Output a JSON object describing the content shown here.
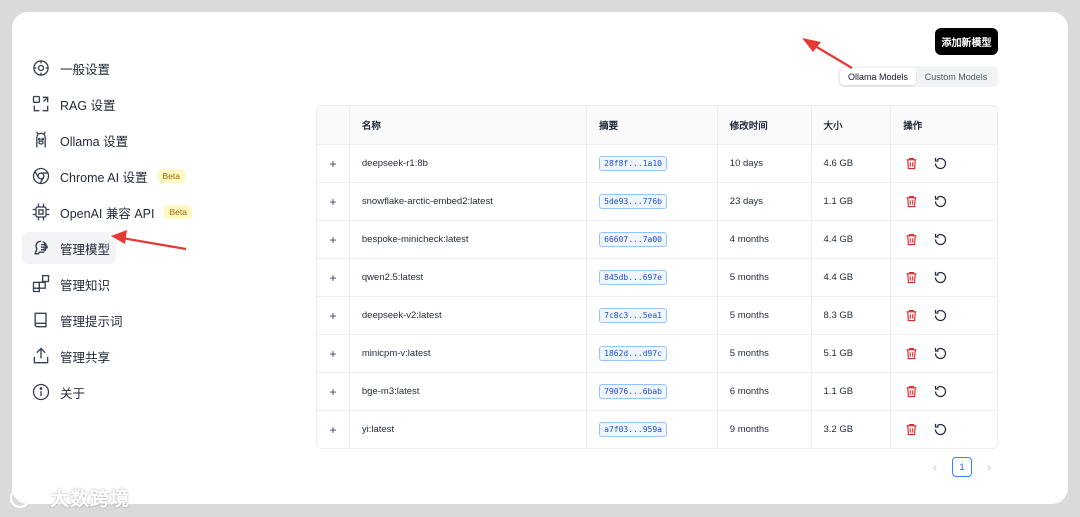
{
  "sidebar": {
    "items": [
      {
        "label": "一般设置",
        "icon": "settings-icon"
      },
      {
        "label": "RAG 设置",
        "icon": "rag-icon"
      },
      {
        "label": "Ollama 设置",
        "icon": "llama-icon"
      },
      {
        "label": "Chrome AI 设置",
        "icon": "chrome-icon",
        "badge": "Beta"
      },
      {
        "label": "OpenAI 兼容 API",
        "icon": "chip-icon",
        "badge": "Beta"
      },
      {
        "label": "管理模型",
        "icon": "brain-icon",
        "active": true
      },
      {
        "label": "管理知识",
        "icon": "blocks-icon"
      },
      {
        "label": "管理提示词",
        "icon": "book-icon"
      },
      {
        "label": "管理共享",
        "icon": "share-icon"
      },
      {
        "label": "关于",
        "icon": "info-icon"
      }
    ]
  },
  "header": {
    "add_button": "添加新模型",
    "tabs": [
      {
        "label": "Ollama Models",
        "active": true
      },
      {
        "label": "Custom Models",
        "active": false
      }
    ]
  },
  "table": {
    "columns": [
      "名称",
      "摘要",
      "修改时间",
      "大小",
      "操作"
    ],
    "expand_symbol": "+",
    "rows": [
      {
        "name": "deepseek-r1:8b",
        "digest": "28f8f...1a10",
        "modified": "10 days",
        "size": "4.6 GB"
      },
      {
        "name": "snowflake-arctic-embed2:latest",
        "digest": "5de93...776b",
        "modified": "23 days",
        "size": "1.1 GB"
      },
      {
        "name": "bespoke-minicheck:latest",
        "digest": "66607...7a00",
        "modified": "4 months",
        "size": "4.4 GB"
      },
      {
        "name": "qwen2.5:latest",
        "digest": "845db...697e",
        "modified": "5 months",
        "size": "4.4 GB"
      },
      {
        "name": "deepseek-v2:latest",
        "digest": "7c8c3...5ea1",
        "modified": "5 months",
        "size": "8.3 GB"
      },
      {
        "name": "minicpm-v:latest",
        "digest": "1862d...d97c",
        "modified": "5 months",
        "size": "5.1 GB"
      },
      {
        "name": "bge-m3:latest",
        "digest": "79076...6bab",
        "modified": "6 months",
        "size": "1.1 GB"
      },
      {
        "name": "yi:latest",
        "digest": "a7f03...959a",
        "modified": "9 months",
        "size": "3.2 GB"
      }
    ],
    "row_actions": [
      "trash-icon",
      "refresh-icon"
    ]
  },
  "pagination": {
    "current_page": "1",
    "prev": "‹",
    "next": "›"
  },
  "colors": {
    "accent": "#000000",
    "delete": "#dc2626",
    "annotation_arrow": "#e53935",
    "digest_text": "#1d4ed8"
  },
  "watermark": {
    "text": "大数跨境"
  }
}
